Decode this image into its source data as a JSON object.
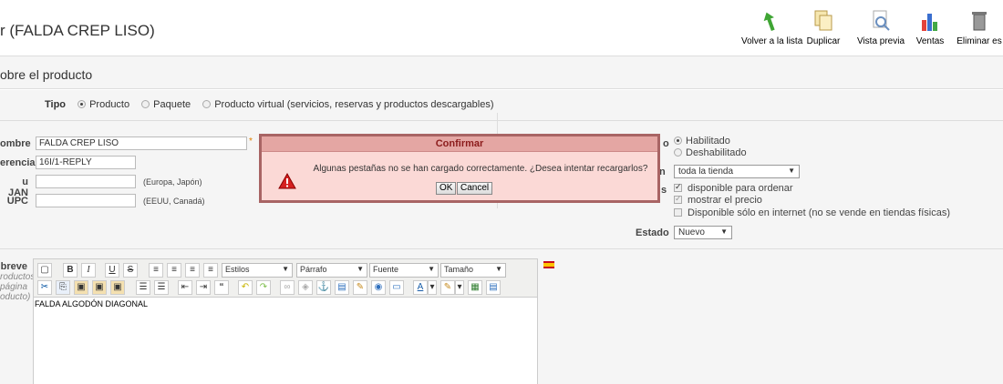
{
  "header": {
    "title": "r (FALDA CREP LISO)",
    "toolbar": [
      {
        "label": "Volver a la lista",
        "icon": "back-arrow-icon"
      },
      {
        "label": "Duplicar",
        "icon": "duplicate-icon"
      },
      {
        "label": "Vista previa",
        "icon": "preview-icon"
      },
      {
        "label": "Ventas",
        "icon": "sales-chart-icon"
      },
      {
        "label": "Eliminar es",
        "icon": "trash-icon"
      }
    ]
  },
  "section": {
    "title": "obre el producto",
    "tipo": {
      "label": "Tipo",
      "options": [
        "Producto",
        "Paquete",
        "Producto virtual (servicios, reservas y productos descargables)"
      ],
      "selected": "Producto"
    }
  },
  "fields": {
    "nombre": {
      "label": "ombre",
      "value": "FALDA CREP LISO"
    },
    "referencia": {
      "label": "erencia",
      "value": "16I/1-REPLY"
    },
    "jan": {
      "label": "u JAN",
      "value": "",
      "hint": "(Europa, Japón)"
    },
    "upc": {
      "label": "UPC",
      "value": "",
      "hint": "(EEUU, Canadá)"
    }
  },
  "right_panel": {
    "status_label": "o",
    "habilitado": "Habilitado",
    "deshabilitado": "Deshabilitado",
    "visibility_label": "n",
    "visibility_value": "toda la tienda",
    "options_label": "s",
    "disponible_ordenar": "disponible para ordenar",
    "mostrar_precio": "mostrar el precio",
    "solo_internet": "Disponible sólo en internet (no se vende en tiendas físicas)",
    "estado_label": "Estado",
    "estado_value": "Nuevo"
  },
  "resumen": {
    "label": "breve",
    "sub": [
      "roductos",
      "página",
      "oducto)"
    ]
  },
  "editor": {
    "dropdowns": [
      "Estilos",
      "Párrafo",
      "Fuente",
      "Tamaño"
    ],
    "content": "FALDA ALGODÓN DIAGONAL"
  },
  "dialog": {
    "title": "Confirmar",
    "message": "Algunas pestañas no se han cargado correctamente. ¿Desea intentar recargarlos?",
    "ok": "OK",
    "cancel": "Cancel"
  },
  "colors": {
    "dialog_bg": "#fbd9d6",
    "dialog_border": "#a86464",
    "dialog_title": "#8b1b1b"
  }
}
